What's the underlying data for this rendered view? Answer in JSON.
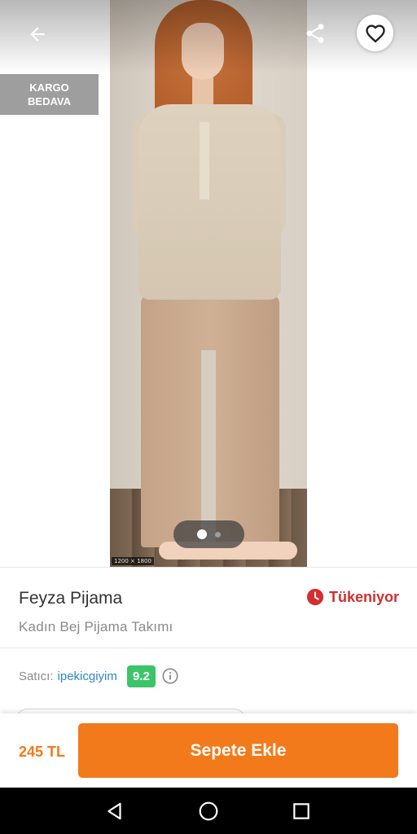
{
  "gallery": {
    "image_size_badge": "1200 × 1800",
    "cargo_badge": {
      "line1": "KARGO",
      "line2": "BEDAVA"
    },
    "slide_count": 2,
    "active_slide": 1
  },
  "header": {
    "back_icon": "arrow-left-icon",
    "share_icon": "share-icon",
    "favorite_icon": "heart-outline-icon"
  },
  "product": {
    "brand": "Feyza Pijama",
    "name": "Kadın Bej Pijama Takımı",
    "stock_status": "Tükeniyor",
    "stock_icon": "clock-icon",
    "stock_color": "#d32f2f"
  },
  "seller": {
    "label": "Satıcı:",
    "name": "ipekicgiyim",
    "score": "9.2",
    "score_color": "#3cc46a"
  },
  "purchase": {
    "price": "245 TL",
    "add_to_cart_label": "Sepete Ekle",
    "accent_color": "#f27a1a"
  },
  "navbar": {
    "back_icon": "triangle-back-icon",
    "home_icon": "circle-home-icon",
    "recents_icon": "square-recents-icon"
  }
}
